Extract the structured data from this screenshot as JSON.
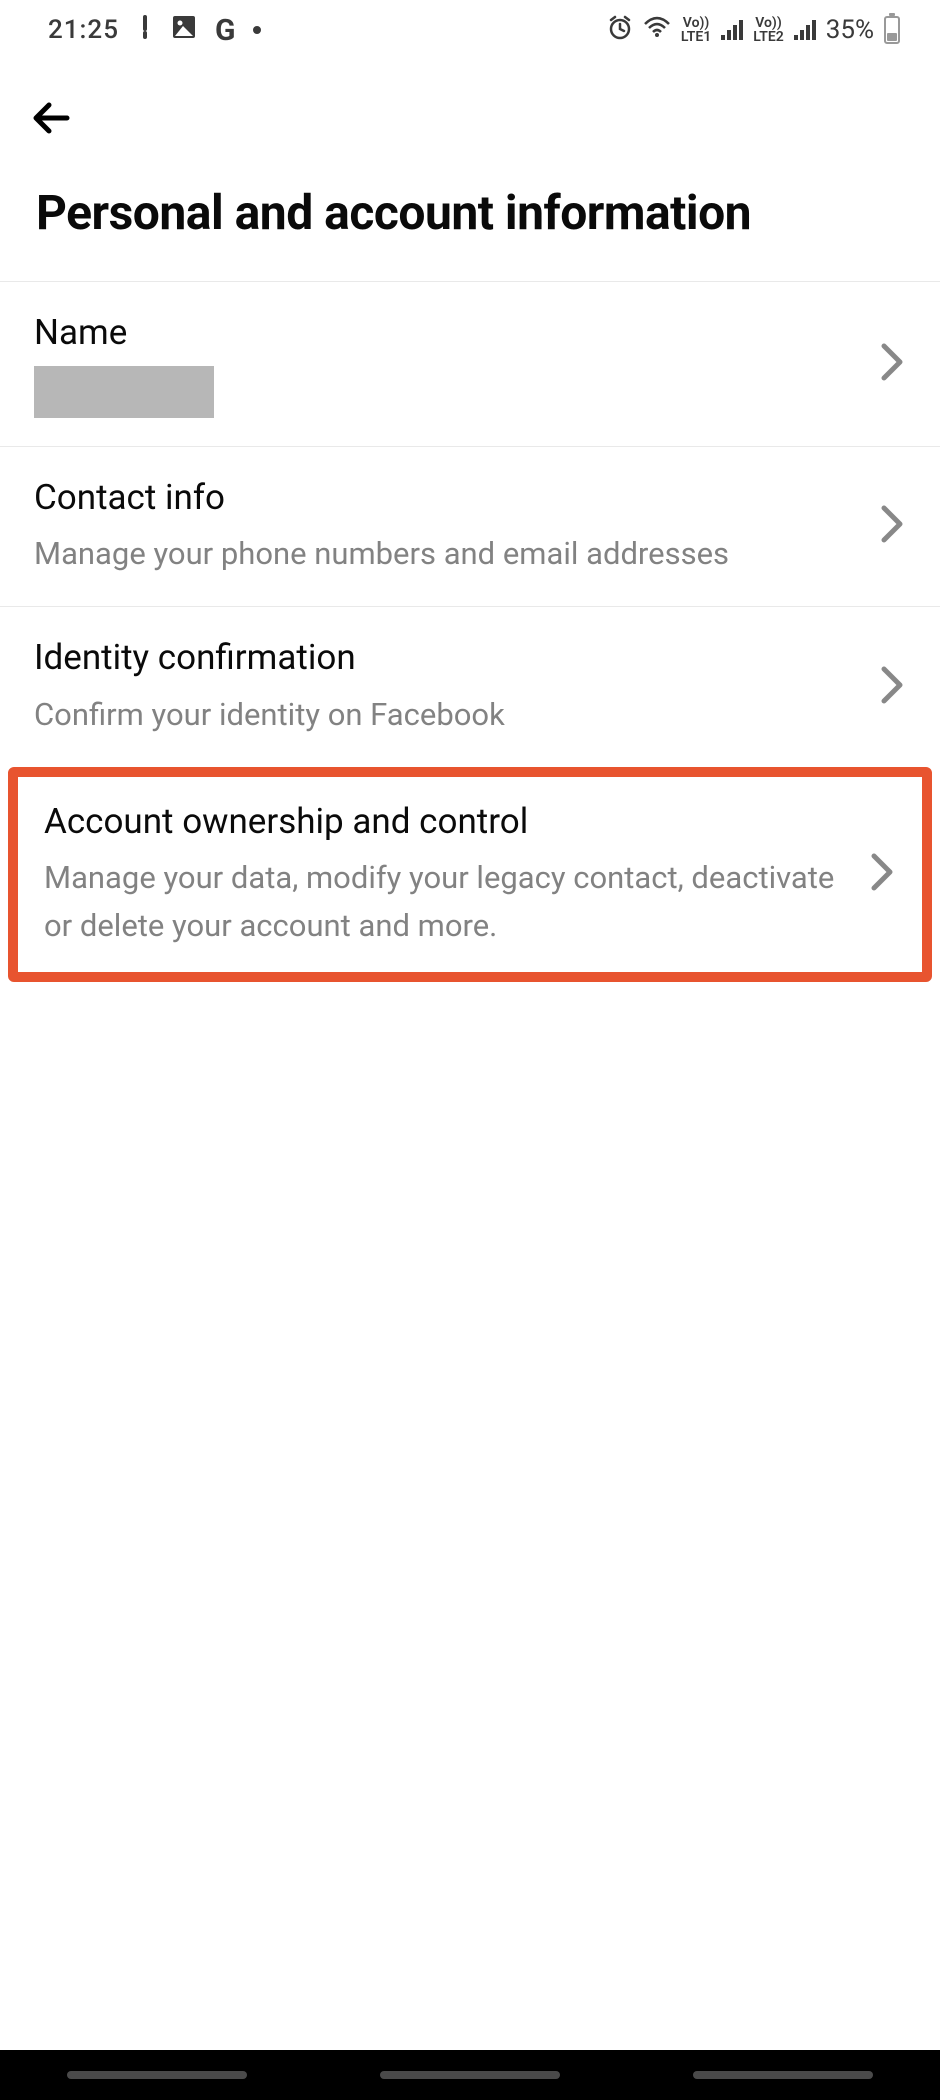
{
  "status": {
    "time": "21:25",
    "lte1": "LTE1",
    "lte2": "LTE2",
    "vo1": "Vo))",
    "vo2": "Vo))",
    "battery_pct": "35%"
  },
  "page": {
    "title": "Personal and account information"
  },
  "rows": {
    "name": {
      "title": "Name"
    },
    "contact": {
      "title": "Contact info",
      "sub": "Manage your phone numbers and email addresses"
    },
    "identity": {
      "title": "Identity confirmation",
      "sub": "Confirm your identity on Facebook"
    },
    "ownership": {
      "title": "Account ownership and control",
      "sub": "Manage your data, modify your legacy contact, deactivate or delete your account and more."
    }
  }
}
